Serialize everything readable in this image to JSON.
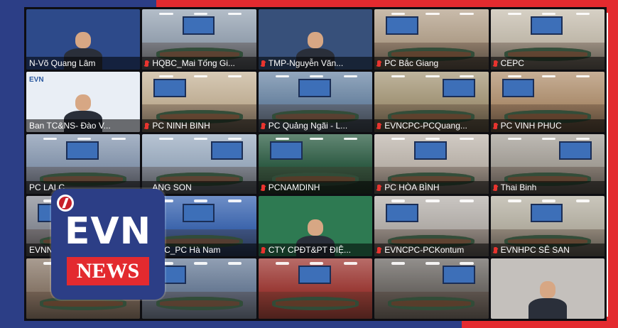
{
  "tiles": [
    {
      "label": "N-Võ Quang Lâm",
      "bg": "#2d4a8a",
      "type": "person",
      "mic": false
    },
    {
      "label": "HQBC_Mai Tống Gi...",
      "bg": "#9aa7b6",
      "type": "room",
      "mic": true
    },
    {
      "label": "TMP-Nguyễn Văn...",
      "bg": "#37507a",
      "type": "person",
      "mic": true
    },
    {
      "label": "PC Bắc Giang",
      "bg": "#b7a58f",
      "type": "room",
      "mic": true
    },
    {
      "label": "CEPC",
      "bg": "#c9c1b2",
      "type": "room",
      "mic": true
    },
    {
      "label": "Ban TC&NS- Đào V...",
      "bg": "#e9eef5",
      "type": "person",
      "mic": false
    },
    {
      "label": "PC NINH BINH",
      "bg": "#c9b79c",
      "type": "room",
      "mic": true
    },
    {
      "label": "PC Quảng Ngãi - L...",
      "bg": "#6f8aa8",
      "type": "room",
      "mic": true
    },
    {
      "label": "EVNCPC-PCQuang...",
      "bg": "#a99b7c",
      "type": "room",
      "mic": true
    },
    {
      "label": "PC VINH PHUC",
      "bg": "#b49473",
      "type": "room",
      "mic": true
    },
    {
      "label": "PC LAI C...",
      "bg": "#8a9bb3",
      "type": "room",
      "mic": false
    },
    {
      "label": "...ANG SON",
      "bg": "#9fb0c4",
      "type": "room",
      "mic": false
    },
    {
      "label": "PCNAMDINH",
      "bg": "#2f5f46",
      "type": "room",
      "mic": true
    },
    {
      "label": "PC HÒA BÌNH",
      "bg": "#c1b9b0",
      "type": "room",
      "mic": true
    },
    {
      "label": "Thai Binh",
      "bg": "#a8a39b",
      "type": "room",
      "mic": true
    },
    {
      "label": "EVNNP...",
      "bg": "#8b8f99",
      "type": "room",
      "mic": false
    },
    {
      "label": "...NPC_PC Hà Nam",
      "bg": "#3e69b4",
      "type": "room",
      "mic": false
    },
    {
      "label": "CTY CPĐT&PT ĐIỆ...",
      "bg": "#2e7a52",
      "type": "person",
      "mic": true
    },
    {
      "label": "EVNCPC-PCKontum",
      "bg": "#b8b3ae",
      "type": "room",
      "mic": true
    },
    {
      "label": "EVNHPC SÊ SAN",
      "bg": "#b9b4a6",
      "type": "room",
      "mic": true
    },
    {
      "label": "",
      "bg": "#8c7b6c",
      "type": "room",
      "mic": false
    },
    {
      "label": "",
      "bg": "#6c7f9a",
      "type": "room",
      "mic": false
    },
    {
      "label": "",
      "bg": "#a03b36",
      "type": "room",
      "mic": false
    },
    {
      "label": "",
      "bg": "#6e6a66",
      "type": "room",
      "mic": false
    },
    {
      "label": "",
      "bg": "#c4c0bc",
      "type": "person",
      "mic": false
    }
  ],
  "evn_header_text": "EVN",
  "logo": {
    "brand": "EVN",
    "word": "NEWS"
  },
  "colors": {
    "blue": "#2c3e86",
    "red": "#e32a2f"
  }
}
